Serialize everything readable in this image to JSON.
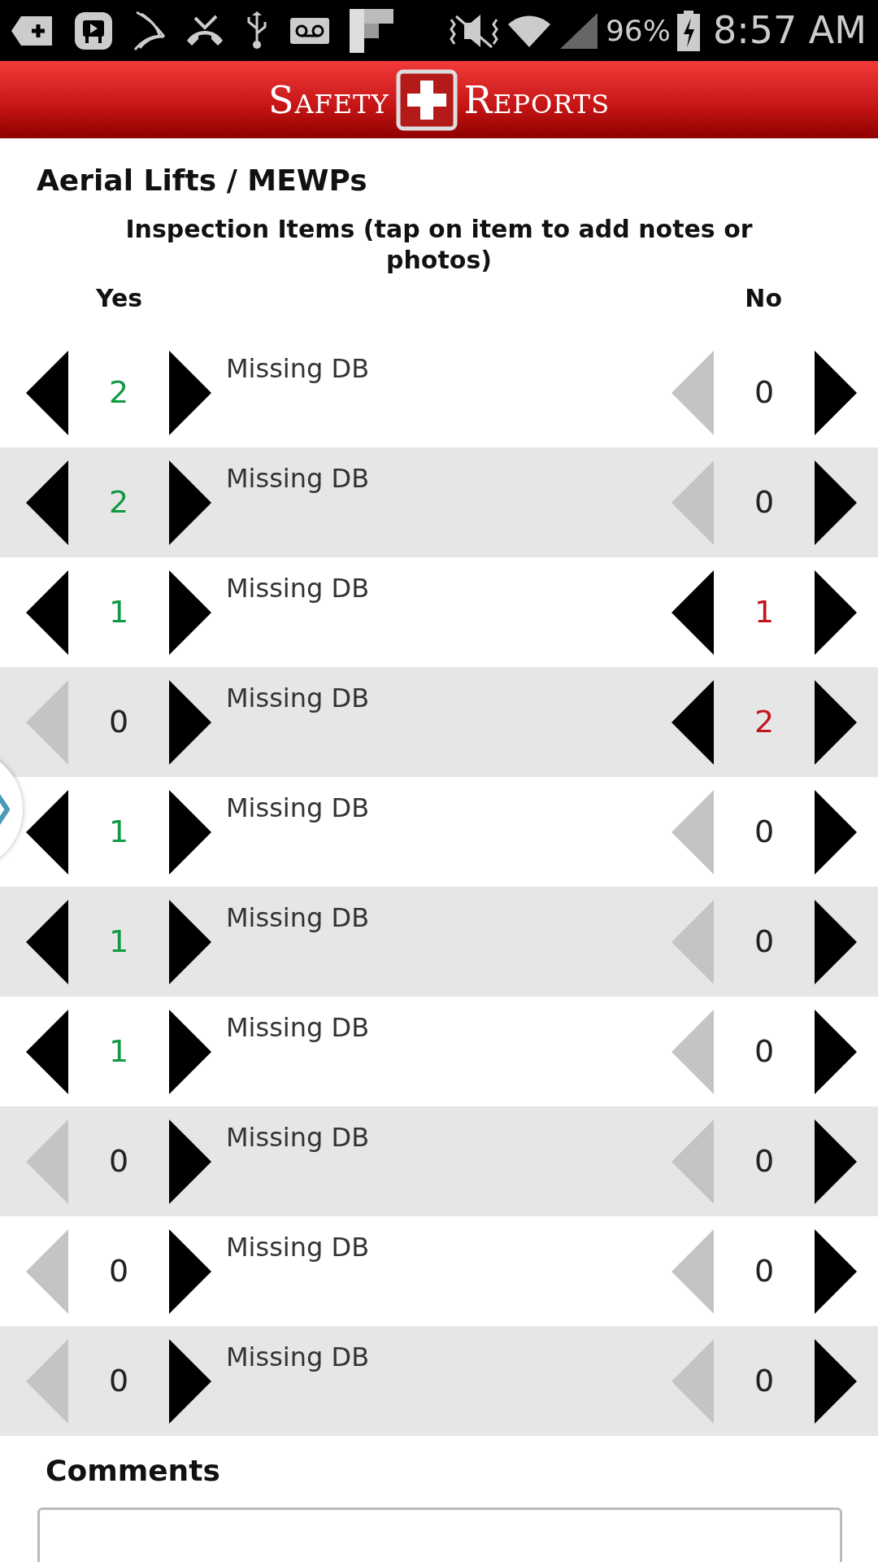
{
  "status_bar": {
    "battery": "96%",
    "time": "8:57 AM"
  },
  "header": {
    "logo_left": "Safety",
    "logo_right": "Reports"
  },
  "title": "Aerial Lifts / MEWPs",
  "subtitle": "Inspection Items (tap on item to add notes or photos)",
  "columns": {
    "yes": "Yes",
    "no": "No"
  },
  "rows": [
    {
      "label": "Missing DB",
      "yes": {
        "count": "2",
        "decrease_disabled": false
      },
      "no": {
        "count": "0",
        "decrease_disabled": true
      }
    },
    {
      "label": "Missing DB",
      "yes": {
        "count": "2",
        "decrease_disabled": false
      },
      "no": {
        "count": "0",
        "decrease_disabled": true
      }
    },
    {
      "label": "Missing DB",
      "yes": {
        "count": "1",
        "decrease_disabled": false
      },
      "no": {
        "count": "1",
        "decrease_disabled": false
      }
    },
    {
      "label": "Missing DB",
      "yes": {
        "count": "0",
        "decrease_disabled": true
      },
      "no": {
        "count": "2",
        "decrease_disabled": false
      }
    },
    {
      "label": "Missing DB",
      "yes": {
        "count": "1",
        "decrease_disabled": false
      },
      "no": {
        "count": "0",
        "decrease_disabled": true
      }
    },
    {
      "label": "Missing DB",
      "yes": {
        "count": "1",
        "decrease_disabled": false
      },
      "no": {
        "count": "0",
        "decrease_disabled": true
      }
    },
    {
      "label": "Missing DB",
      "yes": {
        "count": "1",
        "decrease_disabled": false
      },
      "no": {
        "count": "0",
        "decrease_disabled": true
      }
    },
    {
      "label": "Missing DB",
      "yes": {
        "count": "0",
        "decrease_disabled": true
      },
      "no": {
        "count": "0",
        "decrease_disabled": true
      }
    },
    {
      "label": "Missing DB",
      "yes": {
        "count": "0",
        "decrease_disabled": true
      },
      "no": {
        "count": "0",
        "decrease_disabled": true
      }
    },
    {
      "label": "Missing DB",
      "yes": {
        "count": "0",
        "decrease_disabled": true
      },
      "no": {
        "count": "0",
        "decrease_disabled": true
      }
    }
  ],
  "comments": {
    "label": "Comments"
  }
}
